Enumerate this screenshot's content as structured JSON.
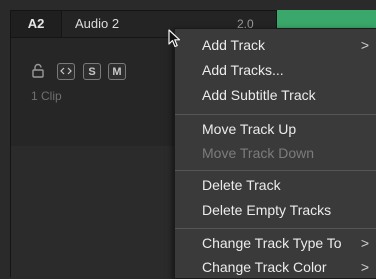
{
  "track": {
    "id": "A2",
    "name": "Audio 2",
    "level": "2.0",
    "clip_count": "1 Clip",
    "solo_label": "S",
    "mute_label": "M"
  },
  "colors": {
    "clip": "#3aa86a",
    "menu_bg": "#3a3a3a",
    "panel_bg": "#262626"
  },
  "context_menu": {
    "items": [
      {
        "label": "Add Track",
        "submenu": true,
        "enabled": true
      },
      {
        "label": "Add Tracks...",
        "submenu": false,
        "enabled": true
      },
      {
        "label": "Add Subtitle Track",
        "submenu": false,
        "enabled": true
      },
      {
        "label": "Move Track Up",
        "submenu": false,
        "enabled": true
      },
      {
        "label": "Move Track Down",
        "submenu": false,
        "enabled": false
      },
      {
        "label": "Delete Track",
        "submenu": false,
        "enabled": true
      },
      {
        "label": "Delete Empty Tracks",
        "submenu": false,
        "enabled": true
      },
      {
        "label": "Change Track Type To",
        "submenu": true,
        "enabled": true
      },
      {
        "label": "Change Track Color",
        "submenu": true,
        "enabled": true
      }
    ],
    "submenu_glyph": ">"
  },
  "icons": [
    "lock-icon",
    "auto-select-icon",
    "mouse-pointer-icon",
    "submenu-chevron-icon"
  ]
}
